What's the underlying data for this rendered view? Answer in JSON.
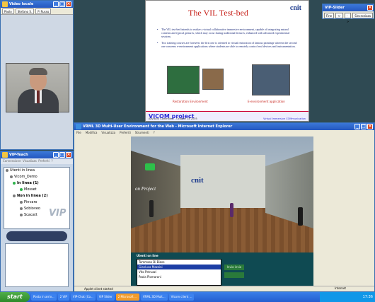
{
  "video_window": {
    "title": "Video locale",
    "tabs": [
      "Paolo",
      "Stefano S.",
      "P. Russo"
    ]
  },
  "chat_window": {
    "title": "VIP-Teach",
    "menu": [
      "Connessione",
      "Visualizza",
      "Preferiti",
      "?"
    ],
    "tree": {
      "root": "Utenti in linea",
      "group": "Vicom_Demo",
      "online_label": "In linea (1)",
      "online_users": [
        "Mosset"
      ],
      "offline_label": "Non in linea (2)",
      "offline_users": [
        "Pinvaro",
        "Sobioveo",
        "Scacatt"
      ]
    },
    "watermark": "VIP"
  },
  "presentation": {
    "title": "The VIL Test-bed",
    "logo": "cnit",
    "bullets": [
      "The VIL test-bed intends to realize a virtual collaborative immersive environment, capable of integrating natural contents and typical gestures, which may occur during traditional lectures, enhanced with advanced experimental sessions.",
      "Two training courses are foreseen: the first one is oriented to virtual restoration of famous paintings whereas the second one concerns e-environment applications where students are able to remotely control real devices and instrumentation."
    ],
    "captions": [
      "Restoration Environment",
      "E-environment application"
    ],
    "footer_title": "VICOM project",
    "footer_left": "Advisory Committee - October 18 2005",
    "footer_right": "Virtual Immersive COMmunication"
  },
  "slider": {
    "title": "VIP-Slider",
    "buttons": [
      "Fine",
      "<-",
      "->",
      "Sincronizza"
    ]
  },
  "browser": {
    "title": "VRML 3D Multi-User Environment for the Web - Microsoft Internet Explorer",
    "menu": [
      "File",
      "Modifica",
      "Visualizza",
      "Preferiti",
      "Strumenti",
      "?"
    ],
    "scene_text_left": "on Project",
    "scene_logo": "cnit",
    "online_header": "Utenti on line",
    "online_users": [
      "Tommaso Di Biase",
      "Gianluca Mazzini",
      "Vito Petruzzi",
      "Paola Piomaroni"
    ],
    "selected_index": 1,
    "send_label": "Invia invio",
    "status": "Applet client started",
    "zone": "Internet"
  },
  "taskbar": {
    "start": "start",
    "tasks": [
      "Posta in arriv...",
      "2 VIP",
      "VIP-Chat (Co...",
      "VIP Slider",
      "2 Microsoft ...",
      "VRML 3D Mult...",
      "VIcom client ..."
    ],
    "active_index": 4,
    "clock": "17:36"
  },
  "colors": {
    "accent": "#2457c0",
    "slide_title": "#c8261f",
    "chat_panel": "#0f4a52",
    "selected_row": "#1c3ea5"
  }
}
